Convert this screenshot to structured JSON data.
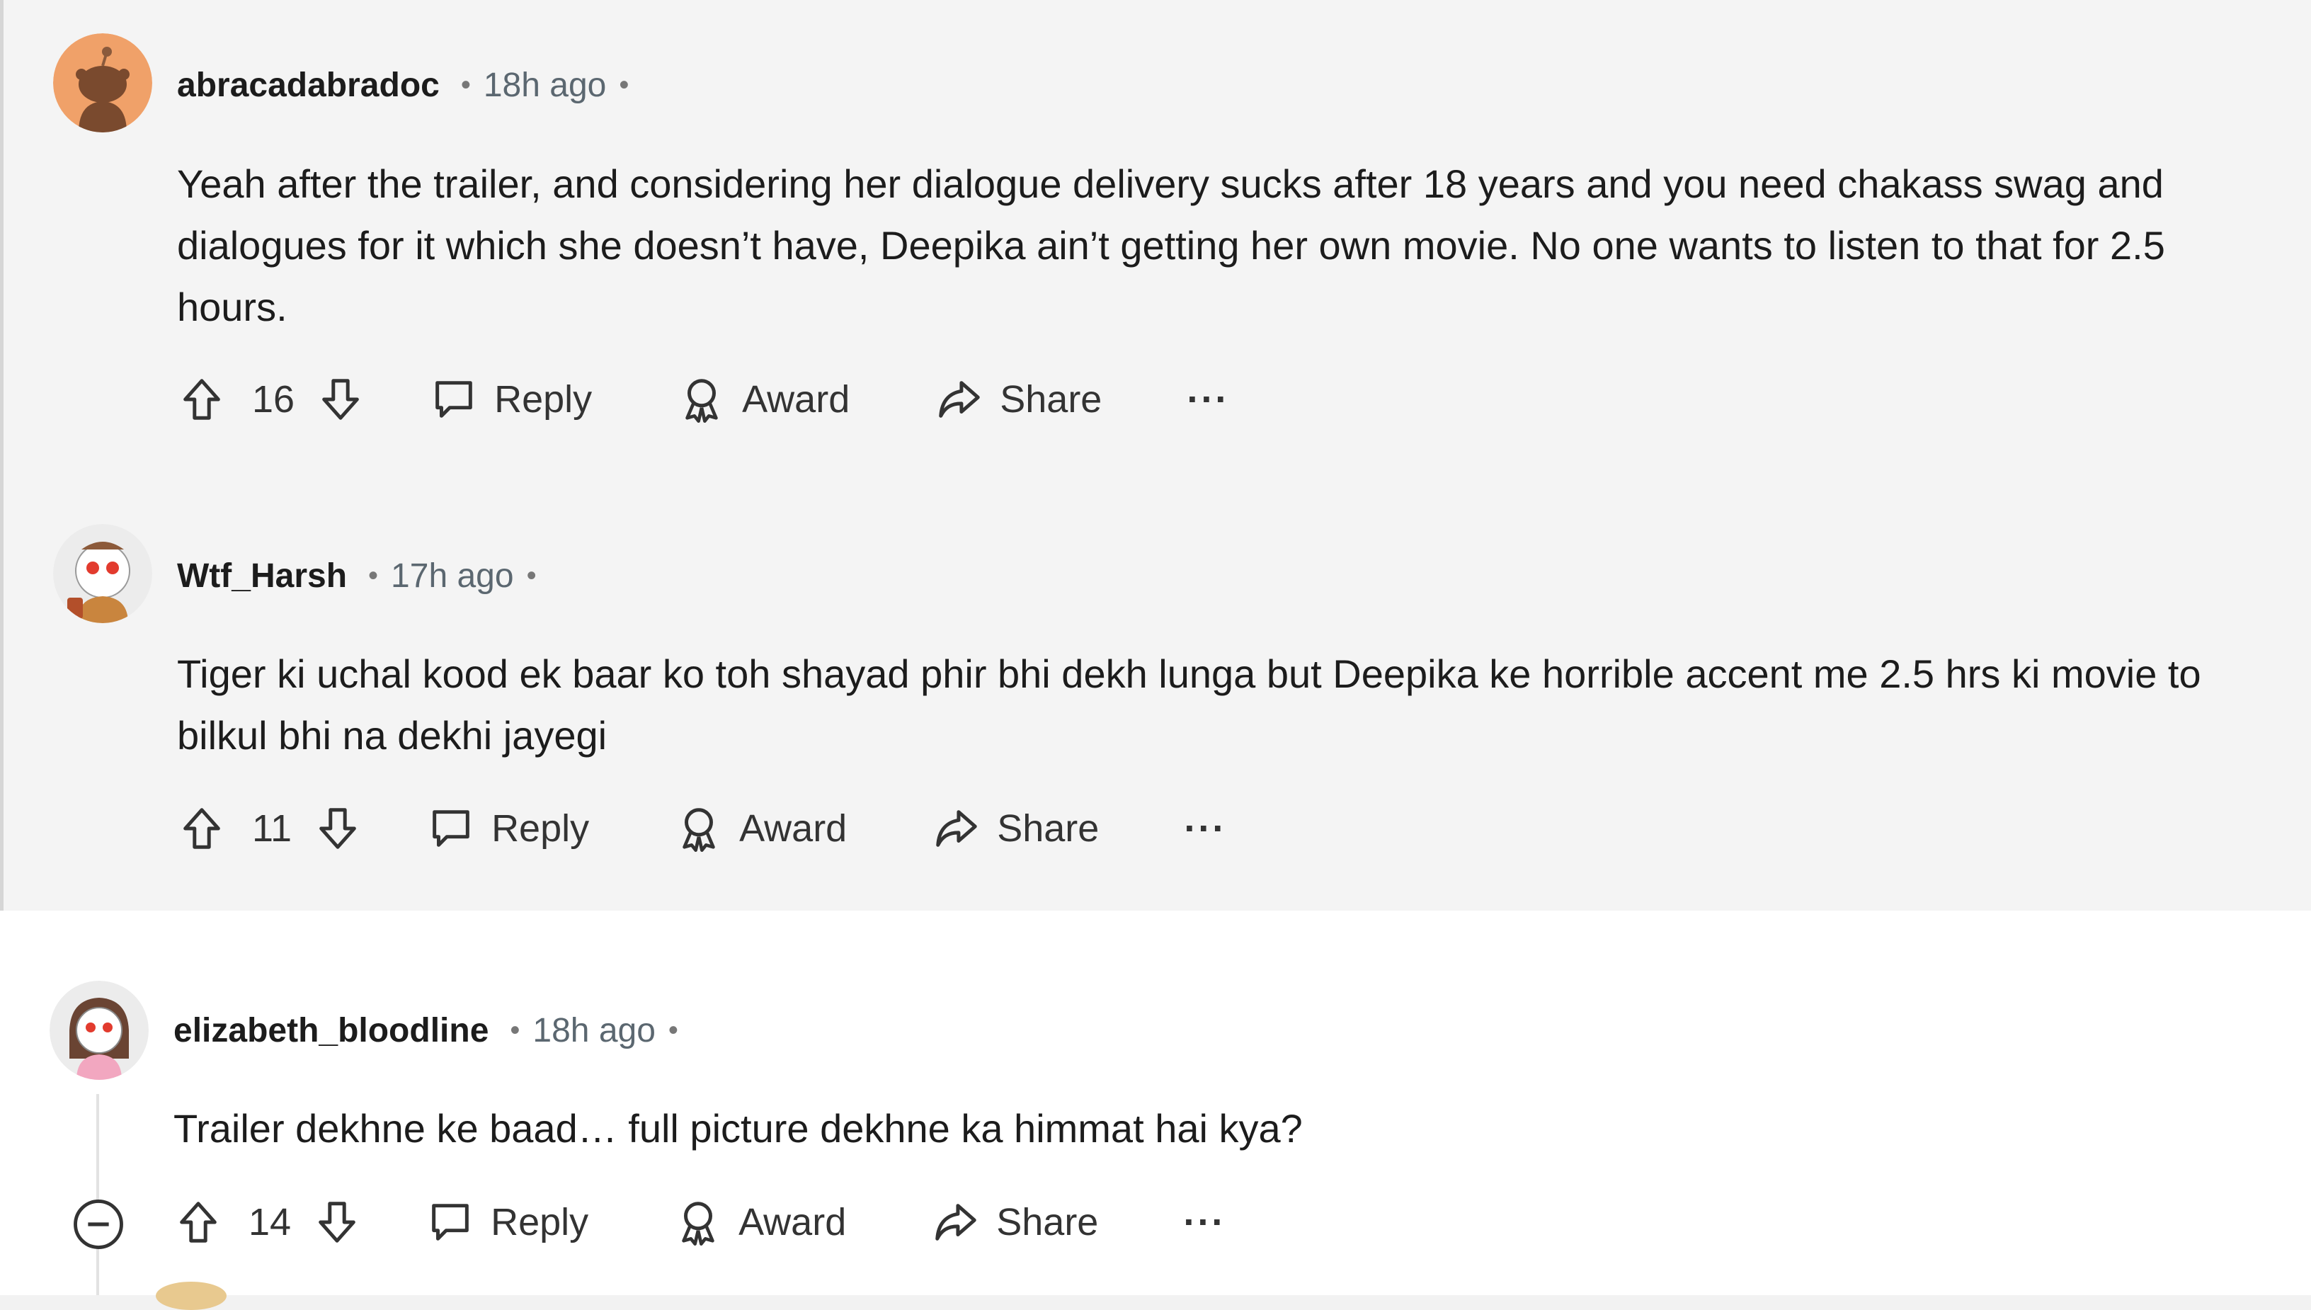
{
  "colors": {
    "background": "#f4f4f4",
    "text": "#1c1c1c",
    "meta": "#5b6770",
    "avatar_orange": "#f0a169"
  },
  "comments": [
    {
      "username": "abracadabradoc",
      "sep": "•",
      "time": "18h ago",
      "sep2": "•",
      "body": "Yeah after the trailer, and considering her dialogue delivery sucks after 18 years and you need chakass swag and dialogues for it which she doesn’t have, Deepika ain’t getting her own movie. No one wants to listen to that for 2.5 hours.",
      "votes": "16",
      "reply": "Reply",
      "award": "Award",
      "share": "Share",
      "more": "···"
    },
    {
      "username": "Wtf_Harsh",
      "sep": "•",
      "time": "17h ago",
      "sep2": "•",
      "body": "Tiger ki uchal kood ek baar ko toh shayad phir bhi dekh lunga but Deepika ke horrible accent me 2.5 hrs ki movie to bilkul bhi na dekhi jayegi",
      "votes": "11",
      "reply": "Reply",
      "award": "Award",
      "share": "Share",
      "more": "···"
    },
    {
      "username": "elizabeth_bloodline",
      "sep": "•",
      "time": "18h ago",
      "sep2": "•",
      "body": "Trailer dekhne ke baad… full picture dekhne ka himmat hai kya?",
      "votes": "14",
      "reply": "Reply",
      "award": "Award",
      "share": "Share",
      "more": "···"
    }
  ]
}
